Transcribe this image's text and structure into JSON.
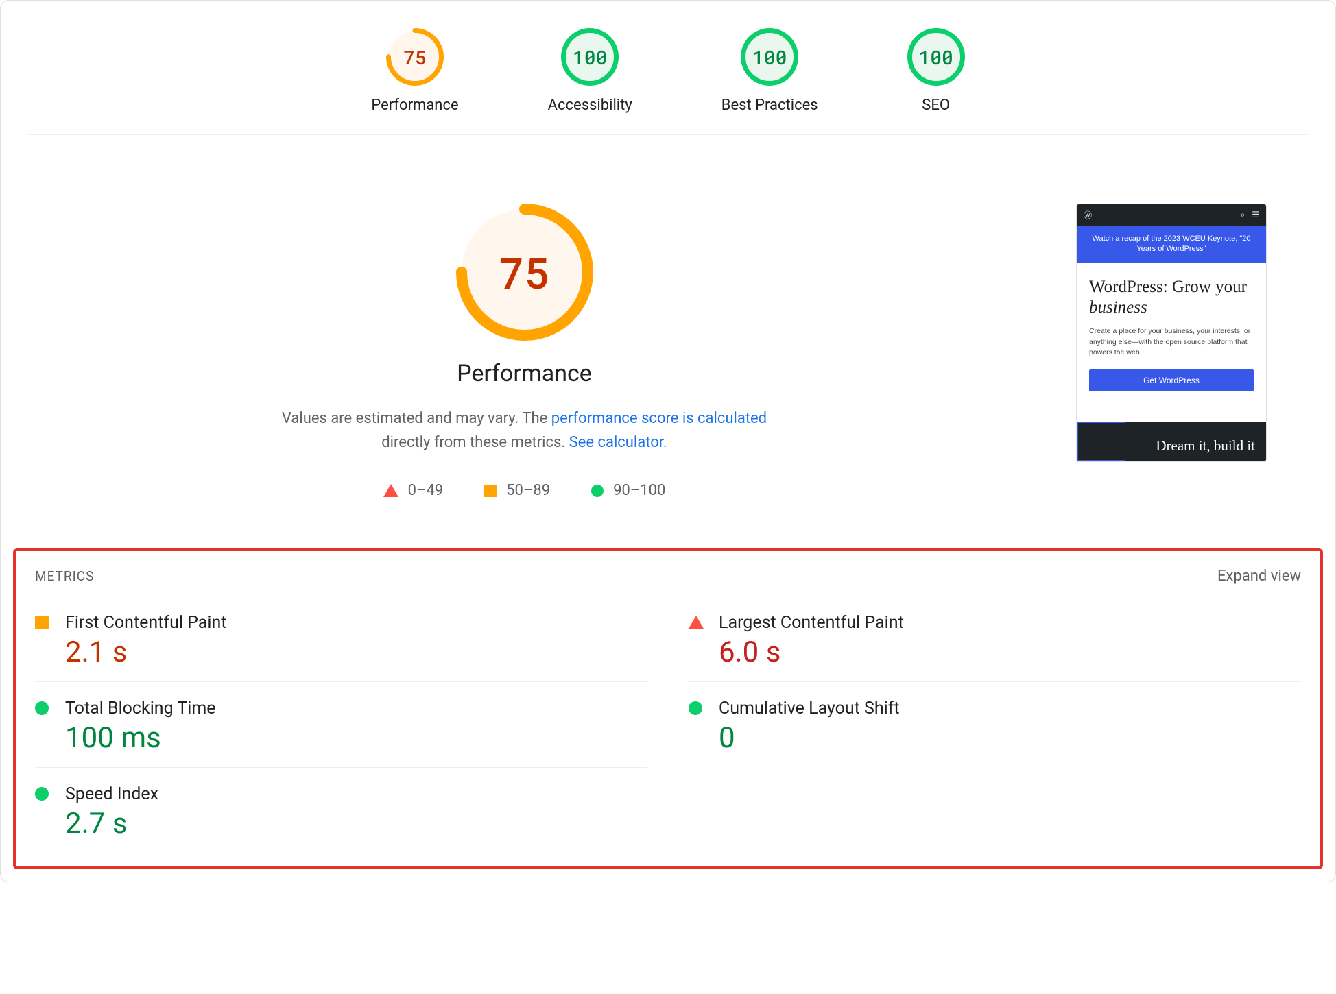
{
  "colors": {
    "orange": "#ffa400",
    "orange_text": "#c33300",
    "orange_fill": "#fff7ed",
    "green": "#0cce6b",
    "green_text": "#018642",
    "green_fill": "#e9f7ef",
    "red": "#ff4e42",
    "red_text": "#c5221f",
    "link": "#1a73e8"
  },
  "gauges": [
    {
      "score": 75,
      "label": "Performance",
      "level": "orange"
    },
    {
      "score": 100,
      "label": "Accessibility",
      "level": "green"
    },
    {
      "score": 100,
      "label": "Best Practices",
      "level": "green"
    },
    {
      "score": 100,
      "label": "SEO",
      "level": "green"
    }
  ],
  "main": {
    "score": 75,
    "label": "Performance",
    "level": "orange",
    "disclaimer_pre": "Values are estimated and may vary. The ",
    "disclaimer_link1": "performance score is calculated",
    "disclaimer_mid": " directly from these metrics. ",
    "disclaimer_link2": "See calculator."
  },
  "legend": [
    {
      "shape": "triangle",
      "range": "0–49"
    },
    {
      "shape": "square",
      "range": "50–89"
    },
    {
      "shape": "circle",
      "range": "90–100"
    }
  ],
  "preview": {
    "banner": "Watch a recap of the 2023 WCEU Keynote, \"20 Years of WordPress\"",
    "hero_title_plain": "WordPress: Grow your ",
    "hero_title_em": "business",
    "hero_body": "Create a place for your business, your interests, or anything else—with the open source platform that powers the web.",
    "cta": "Get WordPress",
    "dark_text": "Dream it, build it"
  },
  "metrics_section": {
    "title": "METRICS",
    "expand": "Expand view"
  },
  "metrics": [
    {
      "name": "First Contentful Paint",
      "value": "2.1 s",
      "level": "orange"
    },
    {
      "name": "Largest Contentful Paint",
      "value": "6.0 s",
      "level": "red"
    },
    {
      "name": "Total Blocking Time",
      "value": "100 ms",
      "level": "green"
    },
    {
      "name": "Cumulative Layout Shift",
      "value": "0",
      "level": "green"
    },
    {
      "name": "Speed Index",
      "value": "2.7 s",
      "level": "green"
    }
  ]
}
